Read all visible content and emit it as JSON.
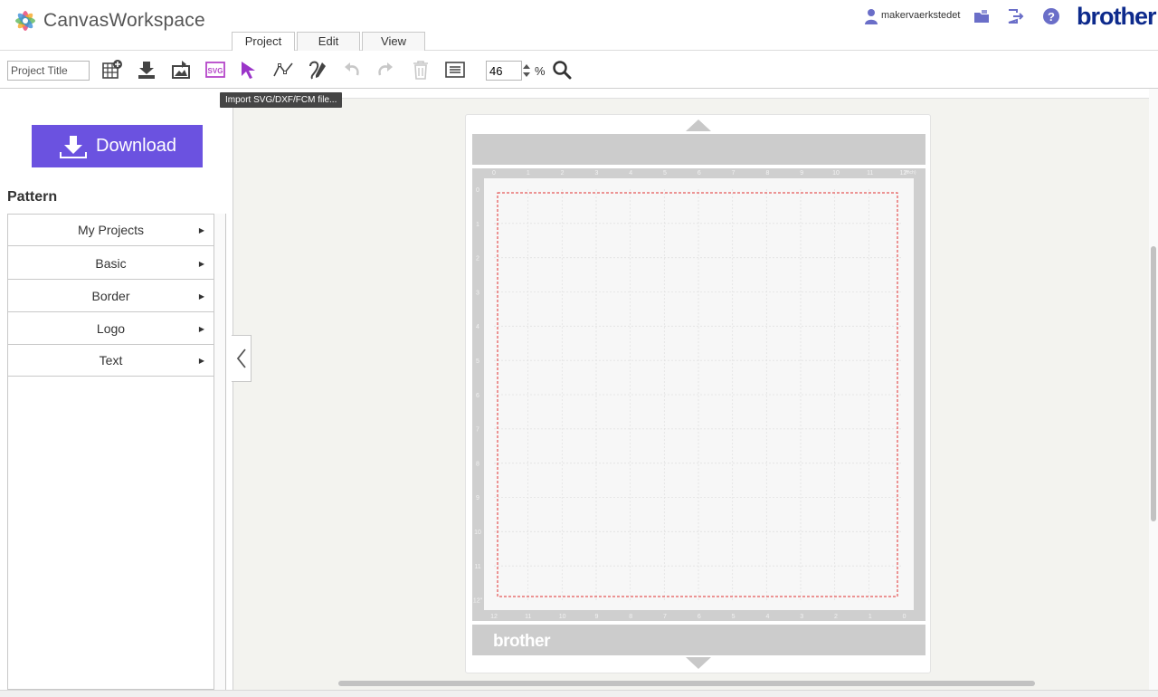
{
  "app": {
    "title": "CanvasWorkspace"
  },
  "menu_tabs": [
    {
      "label": "Project",
      "active": true
    },
    {
      "label": "Edit",
      "active": false
    },
    {
      "label": "View",
      "active": false
    }
  ],
  "user": {
    "name": "makervaerkstedet"
  },
  "brand": {
    "name": "brother",
    "color": "#0d2a8c"
  },
  "toolbar": {
    "project_title_placeholder": "Project Title",
    "zoom_value": "46",
    "zoom_unit": "%",
    "tooltip": "Import SVG/DXF/FCM file...",
    "svg_icon_label": "SVG",
    "icons": [
      "new-project-icon",
      "import-icon",
      "import-image-icon",
      "import-svg-icon",
      "select-arrow-icon",
      "edit-points-icon",
      "draw-icon",
      "undo-icon",
      "redo-icon",
      "delete-icon",
      "properties-icon",
      "zoom-icon"
    ]
  },
  "sidebar": {
    "download_label": "Download",
    "download_color": "#6b52e0",
    "pattern_heading": "Pattern",
    "items": [
      {
        "label": "My Projects"
      },
      {
        "label": "Basic"
      },
      {
        "label": "Border"
      },
      {
        "label": "Logo"
      },
      {
        "label": "Text"
      }
    ]
  },
  "mat": {
    "brand": "brother",
    "top_numbers": [
      "0",
      "1",
      "2",
      "3",
      "4",
      "5",
      "6",
      "7",
      "8",
      "9",
      "10",
      "11",
      "12\""
    ],
    "side_numbers": [
      "0",
      "1",
      "2",
      "3",
      "4",
      "5",
      "6",
      "7",
      "8",
      "9",
      "10",
      "11",
      "12\""
    ],
    "bottom_numbers": [
      "12",
      "11",
      "10",
      "9",
      "8",
      "7",
      "6",
      "5",
      "4",
      "3",
      "2",
      "1",
      "0"
    ],
    "unit_label": "(inch)",
    "cut_area_color": "#e03030"
  }
}
